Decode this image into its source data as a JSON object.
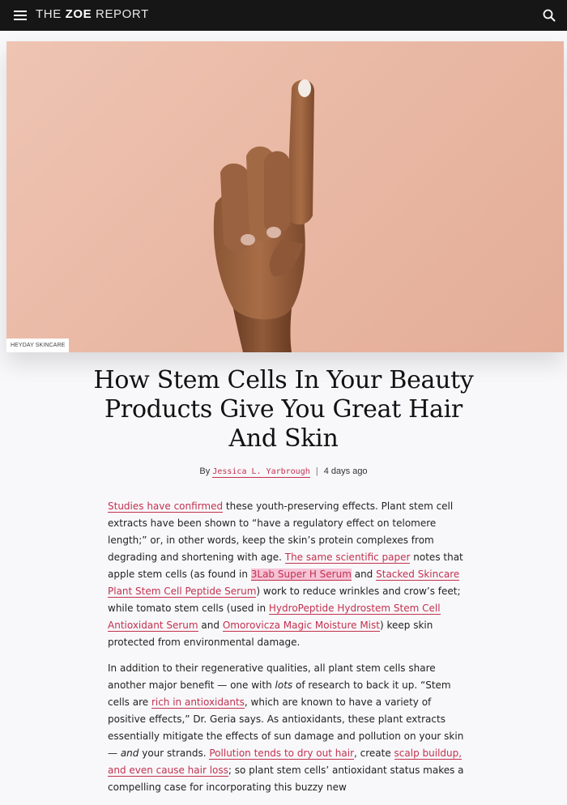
{
  "header": {
    "logo_prefix": "THE",
    "logo_bold": "ZOE",
    "logo_suffix": "REPORT",
    "menu_icon": "hamburger-menu-icon",
    "search_icon": "search-icon",
    "background": "#161616"
  },
  "hero": {
    "photo_credit": "HEYDAY SKINCARE",
    "background_color": "#e9b8a4"
  },
  "article": {
    "title": "How Stem Cells In Your Beauty Products Give You Great Hair And Skin",
    "byline_prefix": "By",
    "author": "Jessica L. Yarbrough",
    "byline_separator": "|",
    "date": "4 days ago",
    "link_color": "#c3314f",
    "p1": {
      "link1": "Studies have confirmed",
      "t1": " these youth-preserving effects. Plant stem cell extracts have been shown to “have a regulatory effect on telomere length;” or, in other words, keep the skin’s protein complexes from degrading and shortening with age. ",
      "link2": "The same scientific paper",
      "t2": " notes that apple stem cells (as found in ",
      "link3": "3Lab Super H Serum",
      "t3": " and ",
      "link4": "Stacked Skincare Plant Stem Cell Peptide Serum",
      "t4": ") work to reduce wrinkles and crow’s feet; while tomato stem cells (used in ",
      "link5": "HydroPeptide Hydrostem Stem Cell Antioxidant Serum",
      "t5": " and ",
      "link6": "Omorovicza Magic Moisture Mist",
      "t6": ") keep skin protected from environmental damage."
    },
    "p2": {
      "t1": "In addition to their regenerative qualities, all plant stem cells share another major benefit — one with ",
      "em1": "lots",
      "t2": " of research to back it up. “Stem cells are ",
      "link1": "rich in antioxidants",
      "t3": ", which are known to have a variety of positive effects,” Dr. Geria says. As antioxidants, these plant extracts essentially mitigate the effects of sun damage and pollution on your skin — ",
      "em2": "and",
      "t4": " your strands. ",
      "link2": "Pollution tends to dry out hair",
      "t5": ", create ",
      "link3": "scalp buildup, and even cause hair loss",
      "t6": "; so plant stem cells’ antioxidant status makes a compelling case for incorporating this buzzy new"
    }
  }
}
